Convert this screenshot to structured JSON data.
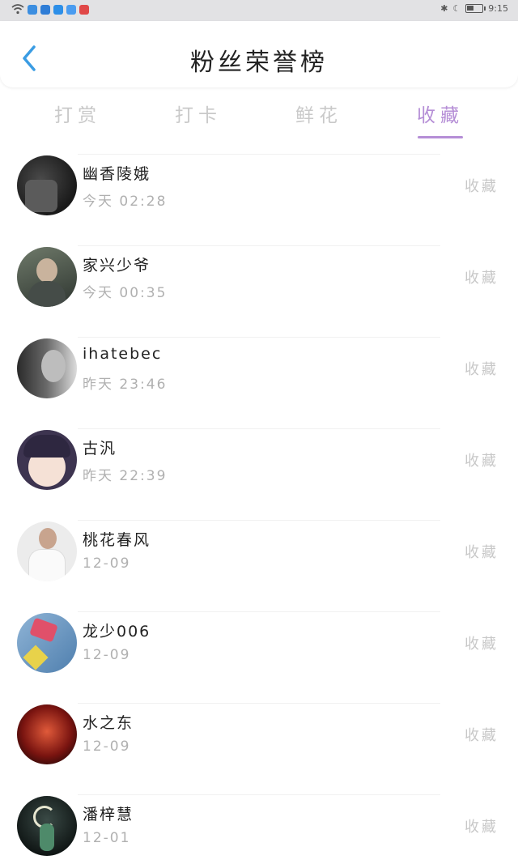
{
  "status_bar": {
    "time": "9:15",
    "app_colors": [
      "#3c8ee0",
      "#2f7dd6",
      "#2d8fe8",
      "#4a9cf0",
      "#e04848"
    ]
  },
  "header": {
    "title": "粉丝荣誉榜",
    "back_icon": "chevron-left-icon",
    "accent": "#3a9ce3"
  },
  "tabs": [
    {
      "label": "打赏",
      "active": false
    },
    {
      "label": "打卡",
      "active": false
    },
    {
      "label": "鲜花",
      "active": false
    },
    {
      "label": "收藏",
      "active": true
    }
  ],
  "accent_color": "#b58ed6",
  "fans": [
    {
      "name": "幽香陵娥",
      "time": "今天 02:28",
      "action": "收藏"
    },
    {
      "name": "家兴少爷",
      "time": "今天 00:35",
      "action": "收藏"
    },
    {
      "name": "ihatebec",
      "time": "昨天 23:46",
      "action": "收藏"
    },
    {
      "name": "古汎",
      "time": "昨天 22:39",
      "action": "收藏"
    },
    {
      "name": "桃花春风",
      "time": "12-09",
      "action": "收藏"
    },
    {
      "name": "龙少006",
      "time": "12-09",
      "action": "收藏"
    },
    {
      "name": "水之东",
      "time": "12-09",
      "action": "收藏"
    },
    {
      "name": "潘梓慧",
      "time": "12-01",
      "action": "收藏"
    }
  ]
}
